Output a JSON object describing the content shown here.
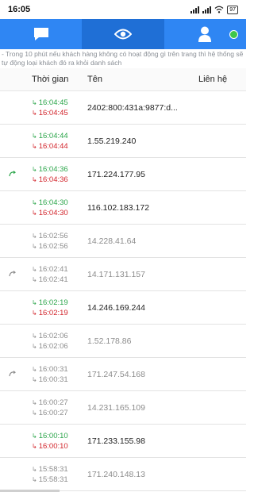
{
  "status_bar": {
    "time": "16:05",
    "battery": "97"
  },
  "tabs": [
    {
      "name": "chat",
      "icon": "chat-bubble-icon"
    },
    {
      "name": "visitors",
      "icon": "eye-icon"
    },
    {
      "name": "profile",
      "icon": "person-icon"
    }
  ],
  "notice": "- Trong 10 phút nếu khách hàng không có hoạt động gì trên trang thì hệ thống sẽ tự động loại khách đó ra khỏi danh sách",
  "table": {
    "headers": {
      "time": "Thời gian",
      "name": "Tên",
      "contact": "Liên hệ"
    },
    "rows": [
      {
        "time_in": "16:04:45",
        "time_out": "16:04:45",
        "name": "2402:800:431a:9877:d...",
        "active": true,
        "returning": false
      },
      {
        "time_in": "16:04:44",
        "time_out": "16:04:44",
        "name": "1.55.219.240",
        "active": true,
        "returning": false
      },
      {
        "time_in": "16:04:36",
        "time_out": "16:04:36",
        "name": "171.224.177.95",
        "active": true,
        "returning": true
      },
      {
        "time_in": "16:04:30",
        "time_out": "16:04:30",
        "name": "116.102.183.172",
        "active": true,
        "returning": false
      },
      {
        "time_in": "16:02:56",
        "time_out": "16:02:56",
        "name": "14.228.41.64",
        "active": false,
        "returning": false
      },
      {
        "time_in": "16:02:41",
        "time_out": "16:02:41",
        "name": "14.171.131.157",
        "active": false,
        "returning": true
      },
      {
        "time_in": "16:02:19",
        "time_out": "16:02:19",
        "name": "14.246.169.244",
        "active": true,
        "returning": false
      },
      {
        "time_in": "16:02:06",
        "time_out": "16:02:06",
        "name": "1.52.178.86",
        "active": false,
        "returning": false
      },
      {
        "time_in": "16:00:31",
        "time_out": "16:00:31",
        "name": "171.247.54.168",
        "active": false,
        "returning": true
      },
      {
        "time_in": "16:00:27",
        "time_out": "16:00:27",
        "name": "14.231.165.109",
        "active": false,
        "returning": false
      },
      {
        "time_in": "16:00:10",
        "time_out": "16:00:10",
        "name": "171.233.155.98",
        "active": true,
        "returning": false
      },
      {
        "time_in": "15:58:31",
        "time_out": "15:58:31",
        "name": "171.240.148.13",
        "active": false,
        "returning": false
      }
    ]
  }
}
